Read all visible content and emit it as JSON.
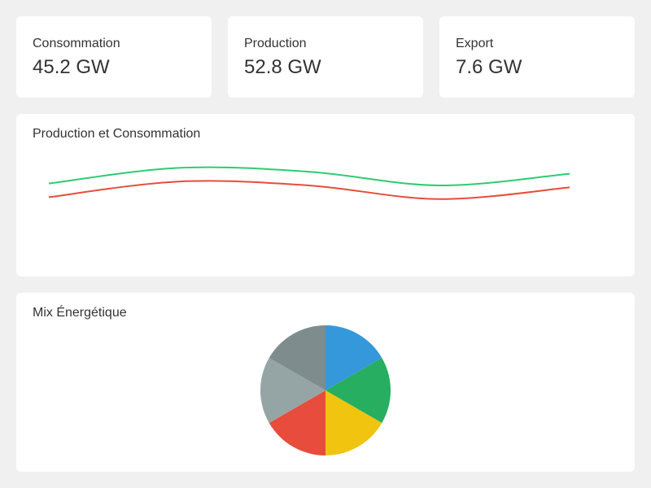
{
  "kpis": [
    {
      "label": "Consommation",
      "value": "45.2 GW"
    },
    {
      "label": "Production",
      "value": "52.8 GW"
    },
    {
      "label": "Export",
      "value": "7.6 GW"
    }
  ],
  "line_panel": {
    "title": "Production et Consommation"
  },
  "pie_panel": {
    "title": "Mix Énergétique"
  },
  "chart_data": [
    {
      "type": "line",
      "title": "Production et Consommation",
      "xlabel": "",
      "ylabel": "",
      "grid": false,
      "legend": "none",
      "x": [
        0,
        1,
        2,
        3,
        4
      ],
      "ylim": [
        0,
        1
      ],
      "series": [
        {
          "color": "#2ecc71",
          "values": [
            0.62,
            0.78,
            0.74,
            0.6,
            0.72
          ]
        },
        {
          "color": "#e74c3c",
          "values": [
            0.48,
            0.64,
            0.6,
            0.46,
            0.58
          ]
        }
      ]
    },
    {
      "type": "pie",
      "title": "Mix Énergétique",
      "legend": "none",
      "values": [
        1,
        1,
        1,
        1,
        1,
        1
      ],
      "colors": [
        "#3498db",
        "#27ae60",
        "#f1c40f",
        "#e74c3c",
        "#95a5a6",
        "#7f8c8d"
      ]
    }
  ]
}
